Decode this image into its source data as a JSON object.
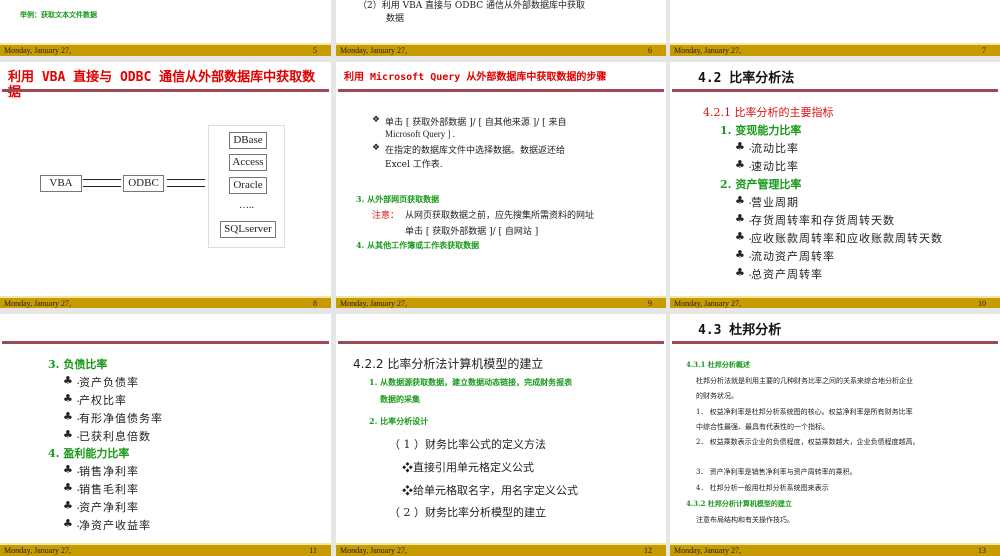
{
  "footer_date": "Monday, January 27,",
  "slides": {
    "s5": {
      "num": "5",
      "text": "举例：获取文本文件数据"
    },
    "s6": {
      "num": "6",
      "line1": "（2）利用 VBA 直接与 ODBC 通信从外部数据库中获取",
      "line2": "数据"
    },
    "s7": {
      "num": "7"
    },
    "s8": {
      "num": "8",
      "title": "利用 VBA 直接与 ODBC 通信从外部数据库中获取数据",
      "diagram": {
        "vba": "VBA",
        "odbc": "ODBC",
        "dbs": [
          "DBase",
          "Access",
          "Oracle"
        ],
        "ellipsis": "…..",
        "last": "SQLserver"
      }
    },
    "s9": {
      "num": "9",
      "title": "利用 Microsoft Query 从外部数据库中获取数据的步骤",
      "bullet_icon": "❖",
      "b1a": "单击 [ 获取外部数据 ]/ [ 自其他来源 ]/ [ 来自",
      "b1b": "Microsoft Query ] .",
      "b2a": "在指定的数据库文件中选择数据。数据返还给",
      "b2b": "Excel 工作表.",
      "item3": "3. 从外部网页获取数据",
      "note_label": "注意：",
      "note": "从网页获取数据之前，应先搜集所需资料的网址",
      "note2": "单击 [ 获取外部数据 ]/ [ 自网站 ]",
      "item4": "4.  从其他工作簿或工作表获取数据"
    },
    "s10": {
      "num": "10",
      "title": "4.2  比率分析法",
      "sub": "4.2.1  比率分析的主要指标",
      "club": "♣",
      "g1": "1. 变现能力比率",
      "g1_items": [
        "流动比率",
        "速动比率"
      ],
      "g2": "2. 资产管理比率",
      "g2_items": [
        "营业周期",
        "存货周转率和存货周转天数",
        "应收账款周转率和应收账款周转天数",
        "流动资产周转率",
        "总资产周转率"
      ]
    },
    "s11": {
      "num": "11",
      "g3": "3. 负债比率",
      "g3_items": [
        "资产负债率",
        "产权比率",
        "有形净值债务率",
        "已获利息倍数"
      ],
      "g4": "4. 盈利能力比率",
      "g4_items": [
        "销售净利率",
        "销售毛利率",
        "资产净利率",
        "净资产收益率"
      ]
    },
    "s12": {
      "num": "12",
      "title": "4.2.2  比率分析法计算机模型的建立",
      "i1a": "1. 从数据源获取数据，建立数据动态链接，完成财务报表",
      "i1b": "数据的采集",
      "i2": "2. 比率分析设计",
      "p1": "（ 1 ）财务比率公式的定义方法",
      "d1": "❖直接引用单元格定义公式",
      "d2": "❖给单元格取名字，用名字定义公式",
      "p2": "（ 2 ）财务比率分析模型的建立"
    },
    "s13": {
      "num": "13",
      "title": "4.3  杜邦分析",
      "sub1": "4.3.1 杜邦分析概述",
      "p1a": "杜邦分析法就是利用主要的几种财务比率之间的关系来综合地分析企业",
      "p1b": "的财务状况。",
      "p2a": "1． 权益净利率是杜邦分析系统图的核心。权益净利率是所有财务比率",
      "p2b": "中综合性最强、最具有代表性的一个指标。",
      "p3": "2． 权益乘数表示企业的负债程度，权益乘数越大，企业负债程度越高。",
      "p4": "3． 资产净利率是销售净利率与资产周转率的乘积。",
      "p5": "4． 杜邦分析一般用杜邦分析系统图来表示",
      "sub2": "4.3.2  杜邦分析计算机模型的建立",
      "p6": "注意布局结构和有关操作技巧。"
    }
  }
}
